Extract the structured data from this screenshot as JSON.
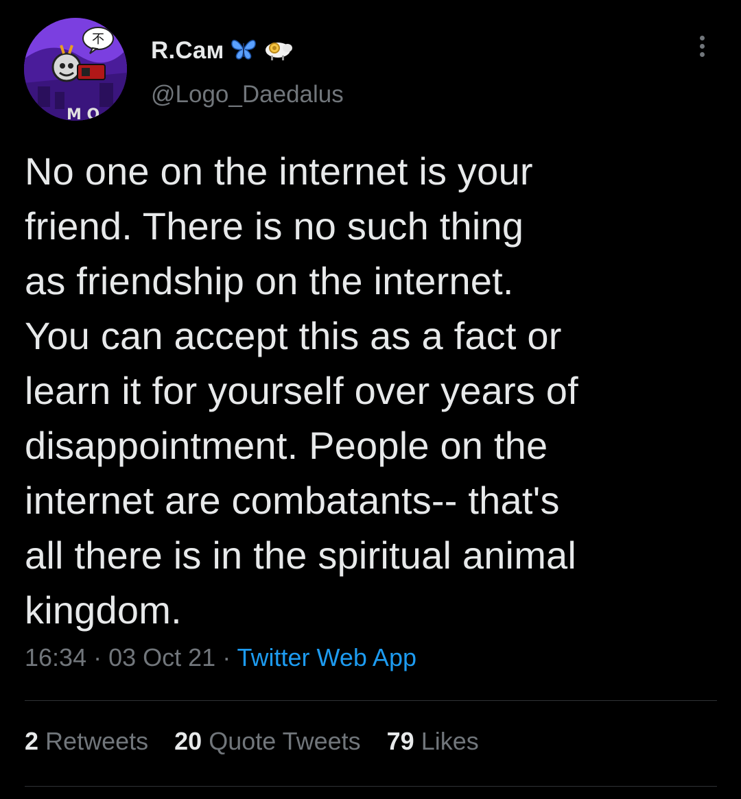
{
  "author": {
    "display_name": "R.Cам",
    "handle": "@Logo_Daedalus",
    "avatar_speech_glyph": "不",
    "avatar_banner_text": "M O",
    "name_emojis": [
      "butterfly-icon",
      "ram-icon"
    ]
  },
  "tweet": {
    "lines": [
      "No one on the internet is your",
      "friend. There is no such thing",
      "as friendship on the internet.",
      "You can accept this as a fact or",
      "learn it for yourself over years of",
      "disappointment. People on the",
      "internet are combatants-- that's",
      "all there is in the spiritual animal",
      "kingdom."
    ],
    "time": "16:34",
    "date": "03 Oct 21",
    "separator": " · ",
    "source": "Twitter Web App"
  },
  "stats": {
    "retweets_count": "2",
    "retweets_label": "Retweets",
    "quotes_count": "20",
    "quotes_label": "Quote Tweets",
    "likes_count": "79",
    "likes_label": "Likes"
  },
  "colors": {
    "background": "#000000",
    "text": "#e7e9ea",
    "muted": "#71767b",
    "link": "#1d9bf0",
    "divider": "#2f3336",
    "butterfly": "#5aa0ff",
    "avatar_purple": "#6a2fc4"
  }
}
